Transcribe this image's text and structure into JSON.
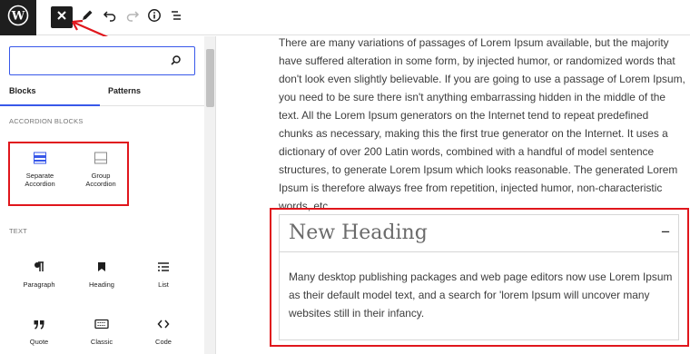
{
  "toolbar": {
    "logo_icon": "wordpress-logo",
    "buttons": [
      "close-icon",
      "pencil-icon",
      "undo-icon",
      "redo-icon",
      "info-icon",
      "list-view-icon"
    ]
  },
  "inserter": {
    "search": {
      "value": "",
      "placeholder": ""
    },
    "tabs": [
      {
        "label": "Blocks",
        "active": true
      },
      {
        "label": "Patterns",
        "active": false
      }
    ],
    "sections": [
      {
        "title": "ACCORDION BLOCKS",
        "blocks": [
          {
            "label_line1": "Separate",
            "label_line2": "Accordion",
            "icon": "separate-accordion-icon"
          },
          {
            "label_line1": "Group",
            "label_line2": "Accordion",
            "icon": "group-accordion-icon"
          }
        ]
      },
      {
        "title": "TEXT",
        "blocks": [
          {
            "label": "Paragraph",
            "icon": "paragraph-icon"
          },
          {
            "label": "Heading",
            "icon": "heading-icon"
          },
          {
            "label": "List",
            "icon": "list-icon"
          },
          {
            "label": "Quote",
            "icon": "quote-icon"
          },
          {
            "label": "Classic",
            "icon": "keyboard-icon"
          },
          {
            "label": "Code",
            "icon": "code-icon"
          }
        ]
      }
    ]
  },
  "content": {
    "paragraph": "There are many variations of passages of Lorem Ipsum available, but the majority have suffered alteration in some form, by injected humor, or randomized words that don't look even slightly believable. If you are going to use a passage of Lorem Ipsum, you need to be sure there isn't anything embarrassing hidden in the middle of the text. All the Lorem Ipsum generators on the Internet tend to repeat predefined chunks as necessary, making this the first true generator on the Internet. It uses a dictionary of over 200 Latin words, combined with a handful of model sentence structures, to generate Lorem Ipsum which looks reasonable. The generated Lorem Ipsum is therefore always free from repetition, injected humor, non-characteristic words, etc.",
    "accordion": {
      "heading": "New Heading",
      "toggle": "−",
      "body": "Many desktop publishing packages and web page editors now use Lorem Ipsum as their default model text, and a search for 'lorem Ipsum will uncover many websites still in their infancy."
    }
  },
  "colors": {
    "accent": "#3858e9",
    "highlight": "#e0161c",
    "dark": "#1e1e1e"
  }
}
